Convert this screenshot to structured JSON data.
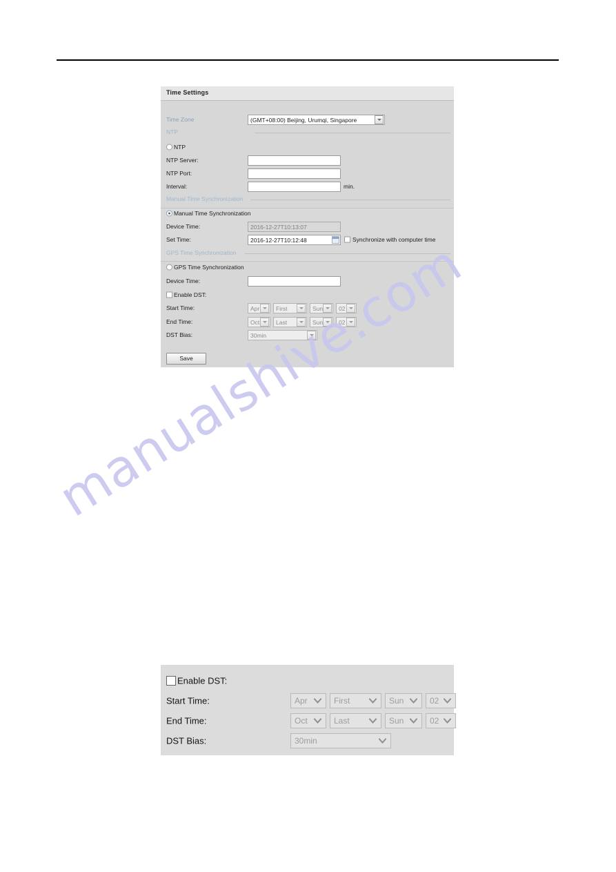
{
  "panel1": {
    "title": "Time Settings",
    "time_zone": {
      "label": "Time Zone",
      "value": "(GMT+08:00) Beijing, Urumqi, Singapore"
    },
    "ntp_section": {
      "header": "NTP",
      "radio_label": "NTP",
      "radio_selected": false,
      "server_label": "NTP Server:",
      "server_value": "",
      "port_label": "NTP Port:",
      "port_value": "",
      "interval_label": "Interval:",
      "interval_value": "",
      "interval_unit": "min."
    },
    "manual_section": {
      "header": "Manual Time Synchronization",
      "radio_label": "Manual Time Synchronization",
      "radio_selected": true,
      "device_time_label": "Device Time:",
      "device_time_value": "2016-12-27T10:13:07",
      "set_time_label": "Set Time:",
      "set_time_value": "2016-12-27T10:12:48",
      "calendar_icon": "calendar-icon",
      "sync_checkbox_label": "Synchronize with computer time",
      "sync_checked": false
    },
    "gps_section": {
      "header": "GPS Time Synchronization",
      "radio_label": "GPS Time Synchronization",
      "radio_selected": false,
      "device_time_label": "Device Time:",
      "device_time_value": ""
    },
    "dst_section": {
      "enable_label": "Enable DST:",
      "enable_checked": false,
      "start_label": "Start Time:",
      "start_month": "Apr",
      "start_week": "First",
      "start_day": "Sun",
      "start_hour": "02",
      "end_label": "End Time:",
      "end_month": "Oct",
      "end_week": "Last",
      "end_day": "Sun",
      "end_hour": "02",
      "bias_label": "DST Bias:",
      "bias_value": "30min"
    },
    "save_label": "Save"
  },
  "panel2": {
    "enable_label": "Enable DST:",
    "enable_checked": false,
    "start_label": "Start Time:",
    "start_month": "Apr",
    "start_week": "First",
    "start_day": "Sun",
    "start_hour": "02",
    "end_label": "End Time:",
    "end_month": "Oct",
    "end_week": "Last",
    "end_day": "Sun",
    "end_hour": "02",
    "bias_label": "DST Bias:",
    "bias_value": "30min"
  },
  "watermark": {
    "text": "manualshive.com",
    "color": "#c7c6ef"
  }
}
